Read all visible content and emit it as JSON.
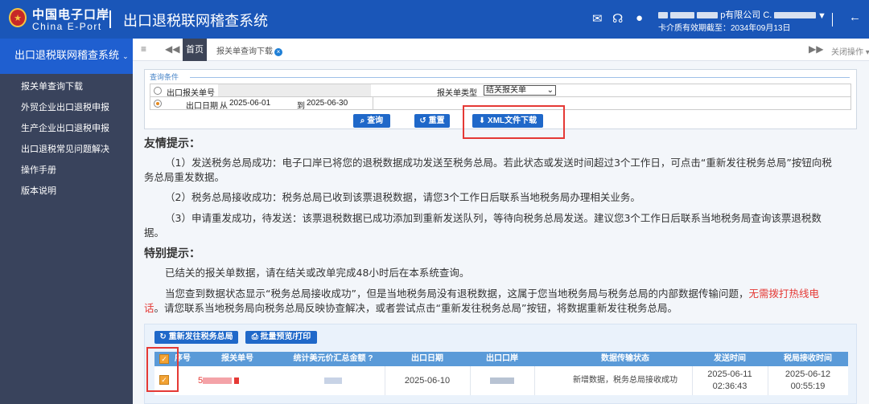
{
  "header": {
    "logo_cn": "中国电子口岸",
    "logo_en": "China E-Port",
    "app_title": "出口退税联网稽查系统",
    "user_name_suffix": "p有限公司 C.",
    "user_expire": "卡介质有效期截至：2034年09月13日"
  },
  "sidebar": {
    "title": "出口退税联网稽查系统",
    "items": [
      "报关单查询下载",
      "外贸企业出口退税申报",
      "生产企业出口退税申报",
      "出口退税常见问题解决",
      "操作手册",
      "版本说明"
    ]
  },
  "tabs": {
    "home": "首页",
    "current": "报关单查询下载",
    "close_ops": "关闭操作"
  },
  "query": {
    "section_title": "查询条件",
    "row1_label": "出口报关单号",
    "doc_type_label": "报关单类型",
    "doc_type_value": "结关报关单",
    "row2_label": "出口日期",
    "from_label": "从",
    "from_date": "2025-06-01",
    "to_label": "到",
    "to_date": "2025-06-30",
    "search_btn": "查询",
    "reset_btn": "重置",
    "xml_btn": "XML文件下载"
  },
  "tips": {
    "title1": "友情提示：",
    "p1": "（1）发送税务总局成功：电子口岸已将您的退税数据成功发送至税务总局。若此状态或发送时间超过3个工作日，可点击“重新发往税务总局”按钮向税务总局重发数据。",
    "p2": "（2）税务总局接收成功：税务总局已收到该票退税数据，请您3个工作日后联系当地税务局办理相关业务。",
    "p3": "（3）申请重发成功，待发送：该票退税数据已成功添加到重新发送队列，等待向税务总局发送。建议您3个工作日后联系当地税务局查询该票退税数据。",
    "title2": "特别提示：",
    "p4": "已结关的报关单数据，请在结关或改单完成48小时后在本系统查询。",
    "p5a": "当您查到数据状态显示“税务总局接收成功”，但是当地税务局没有退税数据，这属于您当地税务局与税务总局的内部数据传输问题，",
    "p5red": "无需拨打热线电话",
    "p5b": "。请您联系当地税务局向税务总局反映协查解决，或者尝试点击“重新发往税务总局”按钮，将数据重新发往税务总局。"
  },
  "grid": {
    "resend_btn": "重新发往税务总局",
    "print_btn": "批量预览/打印",
    "columns": [
      "序号",
      "报关单号",
      "统计美元价汇总金额",
      "出口日期",
      "出口口岸",
      "数据传输状态",
      "发送时间",
      "税局接收时间"
    ],
    "rows": [
      {
        "seq_prefix": "5",
        "export_date": "2025-06-10",
        "status": "新增数据，税务总局接收成功",
        "send_date": "2025-06-11",
        "send_time": "02:36:43",
        "recv_date": "2025-06-12",
        "recv_time": "00:55:19"
      }
    ]
  },
  "colors": {
    "header": "#1a56b8",
    "sidebar": "#39435c",
    "button": "#1f68c9",
    "highlight": "#e53935"
  }
}
